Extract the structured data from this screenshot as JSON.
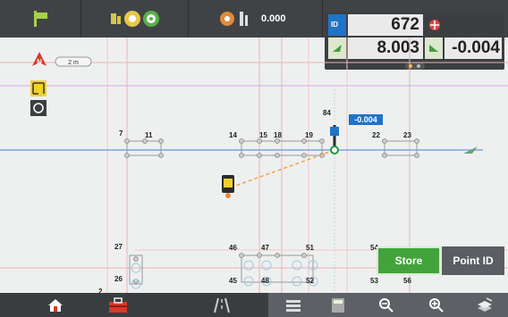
{
  "topbar": {
    "items": [
      {
        "icon": "instrument-flag-icon"
      },
      {
        "icon": "target-prism-icon"
      },
      {
        "icon": "radio-link-icon",
        "value": "0.000"
      }
    ]
  },
  "readout": {
    "id_badge": "ID",
    "id_value": "672",
    "north_value": "8.003",
    "delta_value": "-0.004",
    "page_indicator": "page 1 of 2"
  },
  "map": {
    "north_label": "N",
    "scale_label": "2 m",
    "delta_tag": "-0.004",
    "point_labels": [
      "7",
      "11",
      "14",
      "15",
      "18",
      "19",
      "22",
      "23",
      "84",
      "27",
      "26",
      "2",
      "46",
      "47",
      "51",
      "45",
      "48",
      "52",
      "54",
      "53",
      "56"
    ]
  },
  "actions": {
    "store_label": "Store",
    "point_id_label": "Point ID"
  },
  "bottombar": {
    "buttons": [
      "home-icon",
      "toolbox-icon",
      "road-icon",
      "list-icon",
      "calculator-icon",
      "zoom-out-icon",
      "zoom-in-icon",
      "layers-icon"
    ]
  },
  "colors": {
    "topbar": "#404346",
    "accent_blue": "#1f74c8",
    "store_green": "#43a33b",
    "point_id_gray": "#5a5e62",
    "grid_red": "#e07a7a",
    "grid_blue": "#7aa6e0",
    "current_pos": "#1f9a32"
  }
}
